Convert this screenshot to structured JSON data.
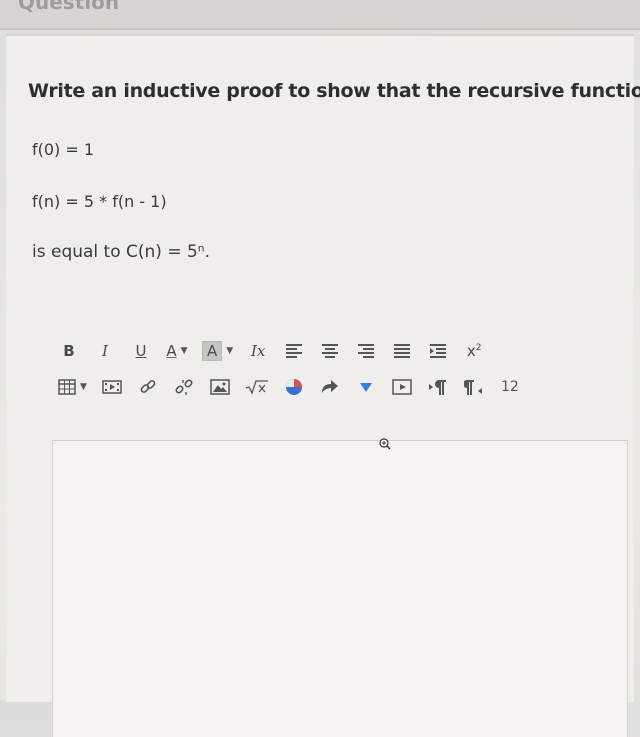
{
  "header": {
    "title": "Question"
  },
  "question": {
    "prompt": "Write an inductive proof to show that the recursive function:",
    "base_case": "f(0) = 1",
    "recurrence": "f(n) = 5 * f(n - 1)",
    "claim": "is equal to C(n) = 5ⁿ."
  },
  "toolbar": {
    "row1": {
      "bold_label": "B",
      "italic_label": "I",
      "underline_label": "U",
      "font_color_label": "A",
      "bg_color_label": "A",
      "clear_format_label": "Ix",
      "superscript_label": "x",
      "superscript_mark": "2"
    },
    "row2": {
      "font_size_label": "12"
    },
    "icons": [
      "bold-icon",
      "italic-icon",
      "underline-icon",
      "font-color-icon",
      "background-color-icon",
      "clear-formatting-icon",
      "align-left-icon",
      "align-center-icon",
      "align-right-icon",
      "align-justify-icon",
      "indent-icon",
      "superscript-icon",
      "table-icon",
      "media-icon",
      "link-icon",
      "unlink-icon",
      "image-icon",
      "equation-icon",
      "ink-icon",
      "redo-icon",
      "chevron-down-icon",
      "video-icon",
      "ltr-paragraph-icon",
      "rtl-paragraph-icon"
    ]
  },
  "editor": {
    "value": ""
  },
  "colors": {
    "page_bg": "#e7e6e2",
    "card_bg": "#efeeea",
    "editor_bg": "#f4f3ef",
    "text": "#2e2e2e",
    "icon": "#4a4a4a",
    "chevron_blue": "#3b7ddd",
    "ink_red": "#d9534f",
    "ink_blue": "#3a6fd0"
  }
}
